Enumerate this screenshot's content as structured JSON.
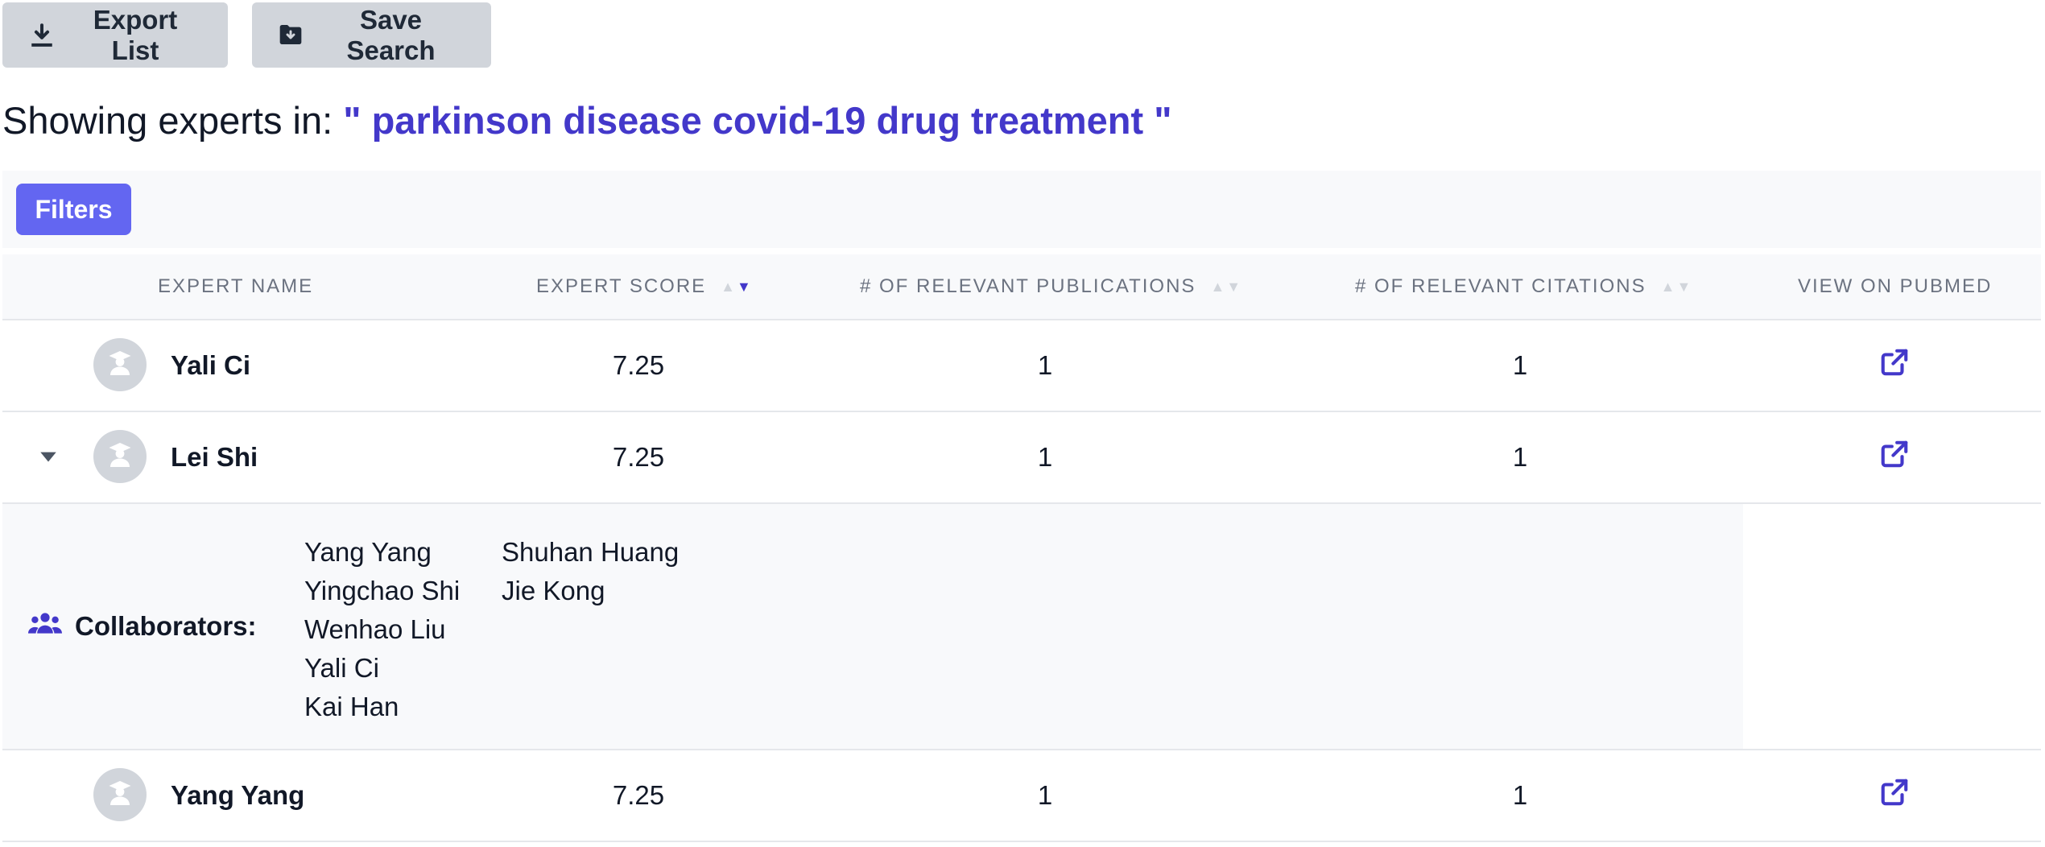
{
  "toolbar": {
    "export_label": "Export List",
    "save_label": "Save Search"
  },
  "heading": {
    "prefix": "Showing experts in: ",
    "query": "\" parkinson disease covid-19 drug treatment \""
  },
  "filters": {
    "label": "Filters"
  },
  "columns": {
    "name": "EXPERT NAME",
    "score": "EXPERT SCORE",
    "publications": "# OF RELEVANT PUBLICATIONS",
    "citations": "# OF RELEVANT CITATIONS",
    "pubmed": "VIEW ON PUBMED"
  },
  "sort": {
    "active_column": "score",
    "direction": "descending"
  },
  "rows": [
    {
      "name": "Yali Ci",
      "score": "7.25",
      "publications": "1",
      "citations": "1",
      "expanded": false
    },
    {
      "name": "Lei Shi",
      "score": "7.25",
      "publications": "1",
      "citations": "1",
      "expanded": true
    },
    {
      "name": "Yang Yang",
      "score": "7.25",
      "publications": "1",
      "citations": "1",
      "expanded": false
    }
  ],
  "collaborators": {
    "label": "Collaborators:",
    "col1": [
      "Yang Yang",
      "Yingchao Shi",
      "Wenhao Liu",
      "Yali Ci",
      "Kai Han"
    ],
    "col2": [
      "Shuhan Huang",
      "Jie Kong"
    ]
  },
  "icons": {
    "export": "download-icon",
    "save": "folder-download-icon",
    "avatar": "user-graduate-icon",
    "pubmed": "external-link-icon",
    "collaborators": "users-icon",
    "expand": "caret-down-icon"
  },
  "colors": {
    "accent": "#4338ca",
    "filters_button": "#6366f1",
    "gray_button": "#d1d5db",
    "header_bg": "#f8f9fb"
  }
}
